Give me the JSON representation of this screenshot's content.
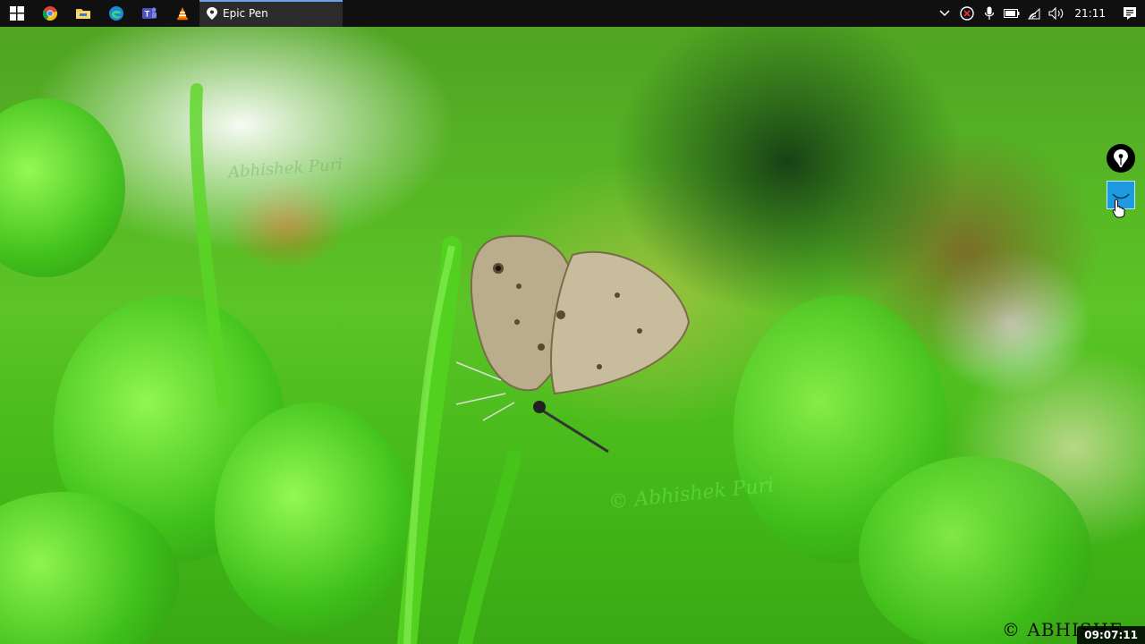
{
  "taskbar": {
    "pinned": [
      {
        "name": "start",
        "icon": "windows-logo-icon"
      },
      {
        "name": "chrome",
        "icon": "chrome-icon"
      },
      {
        "name": "file-explorer",
        "icon": "folder-icon"
      },
      {
        "name": "edge",
        "icon": "edge-icon"
      },
      {
        "name": "teams",
        "icon": "teams-icon"
      },
      {
        "name": "vlc",
        "icon": "vlc-cone-icon"
      }
    ],
    "active_app": {
      "label": "Epic Pen",
      "icon": "pen-nib-icon"
    },
    "tray": {
      "icons": [
        "chevron-up-icon",
        "antivirus-icon",
        "microphone-icon",
        "battery-icon",
        "wifi-icon",
        "volume-icon"
      ],
      "clock": "21:11",
      "notification_icon": "action-center-icon"
    }
  },
  "wallpaper": {
    "subject": "butterfly on green plant",
    "watermark_top": "Abhishek Puri",
    "watermark_center": "© Abhishek Puri",
    "copyright": "© ABHISHE"
  },
  "epic_pen": {
    "logo_icon": "pen-nib-icon",
    "expand_icon": "chevron-down-icon",
    "accent": "#1e9be0"
  },
  "video_timestamp": "09:07:11"
}
